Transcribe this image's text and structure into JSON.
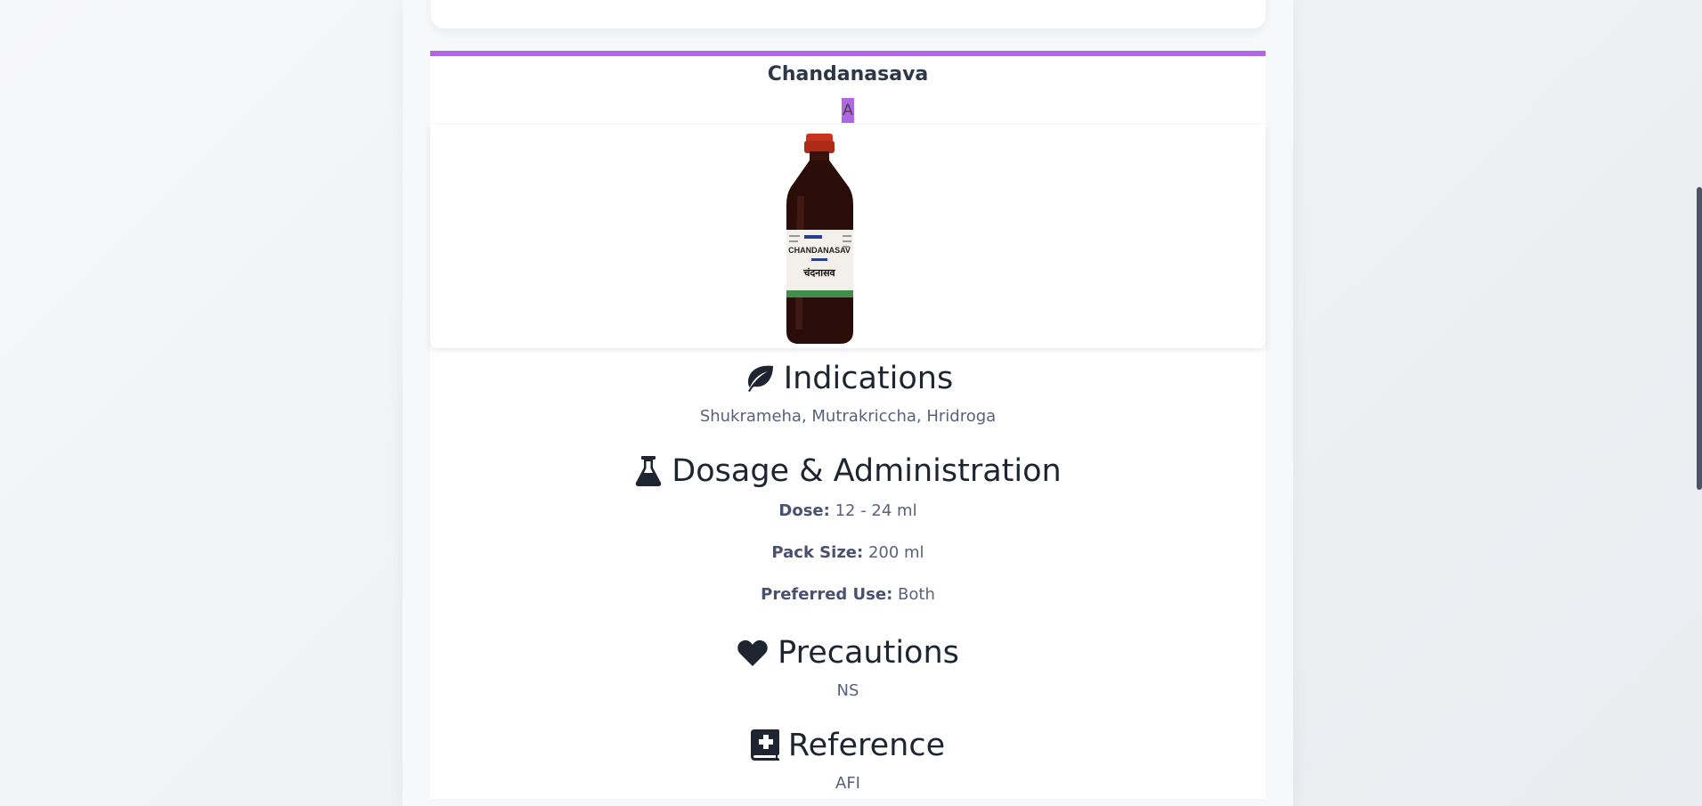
{
  "product": {
    "name": "Chandanasava",
    "badge": "A",
    "image_label": "Chandanasava bottle"
  },
  "sections": {
    "indications": {
      "icon": "leaf-icon",
      "title": "Indications",
      "text": "Shukrameha, Mutrakriccha, Hridroga"
    },
    "dosage": {
      "icon": "flask-icon",
      "title": "Dosage & Administration",
      "dose_label": "Dose:",
      "dose_value": "12 - 24 ml",
      "pack_label": "Pack Size:",
      "pack_value": "200 ml",
      "use_label": "Preferred Use:",
      "use_value": "Both"
    },
    "precautions": {
      "icon": "heart-icon",
      "title": "Precautions",
      "text": "NS"
    },
    "reference": {
      "icon": "book-medical-icon",
      "title": "Reference",
      "text": "AFI"
    }
  },
  "colors": {
    "accent": "#b167e4",
    "heading": "#1f2530",
    "body_text": "#5a607a"
  }
}
